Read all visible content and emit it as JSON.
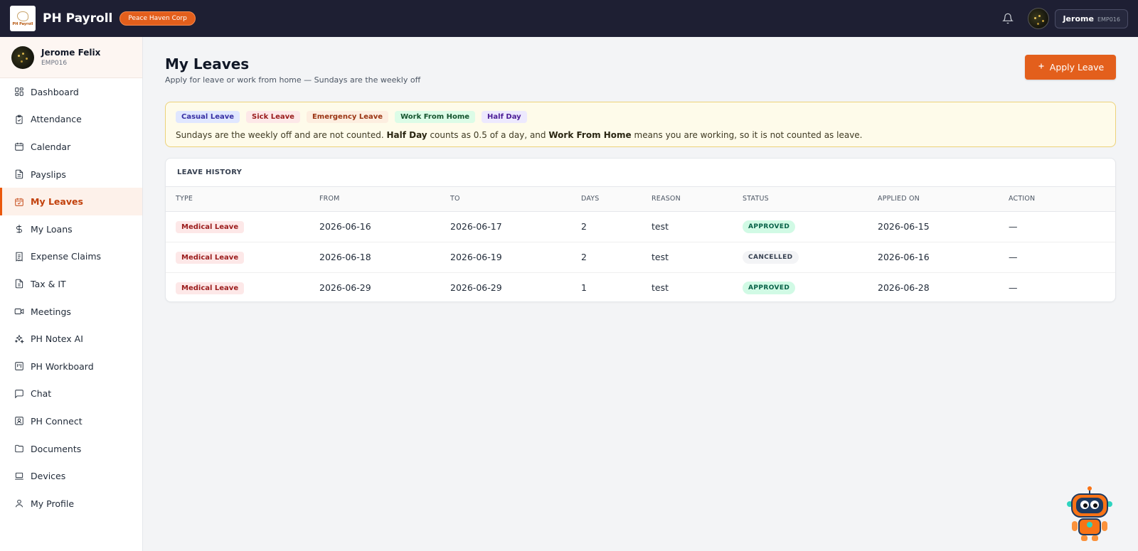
{
  "topbar": {
    "logo_text": "PH Payroll",
    "brand": "PH Payroll",
    "org": "Peace Haven Corp",
    "user_name": "Jerome",
    "user_id": "EMP016"
  },
  "sidebar": {
    "profile": {
      "name": "Jerome Felix",
      "id": "EMP016"
    },
    "items": [
      {
        "label": "Dashboard",
        "icon": "dashboard-icon"
      },
      {
        "label": "Attendance",
        "icon": "clipboard-check-icon"
      },
      {
        "label": "Calendar",
        "icon": "calendar-icon"
      },
      {
        "label": "Payslips",
        "icon": "document-icon"
      },
      {
        "label": "My Leaves",
        "icon": "calendar-check-icon",
        "active": true
      },
      {
        "label": "My Loans",
        "icon": "dollar-icon"
      },
      {
        "label": "Expense Claims",
        "icon": "receipt-icon"
      },
      {
        "label": "Tax & IT",
        "icon": "file-text-icon"
      },
      {
        "label": "Meetings",
        "icon": "video-icon"
      },
      {
        "label": "PH Notex AI",
        "icon": "sparkles-icon"
      },
      {
        "label": "PH Workboard",
        "icon": "kanban-icon"
      },
      {
        "label": "Chat",
        "icon": "chat-icon"
      },
      {
        "label": "PH Connect",
        "icon": "contact-card-icon"
      },
      {
        "label": "Documents",
        "icon": "folder-icon"
      },
      {
        "label": "Devices",
        "icon": "laptop-icon"
      },
      {
        "label": "My Profile",
        "icon": "user-icon"
      }
    ]
  },
  "page": {
    "title": "My Leaves",
    "subtitle": "Apply for leave or work from home — Sundays are the weekly off",
    "apply_button": "Apply Leave"
  },
  "notice": {
    "tags": [
      "Casual Leave",
      "Sick Leave",
      "Emergency Leave",
      "Work From Home",
      "Half Day"
    ],
    "text_1": "Sundays are the weekly off and are not counted. ",
    "bold_1": "Half Day",
    "text_2": " counts as 0.5 of a day, and ",
    "bold_2": "Work From Home",
    "text_3": " means you are working, so it is not counted as leave."
  },
  "leave_history": {
    "title": "LEAVE HISTORY",
    "columns": [
      "TYPE",
      "FROM",
      "TO",
      "DAYS",
      "REASON",
      "STATUS",
      "APPLIED ON",
      "ACTION"
    ],
    "rows": [
      {
        "type": "Medical Leave",
        "from": "2026-06-16",
        "to": "2026-06-17",
        "days": "2",
        "reason": "test",
        "status": "APPROVED",
        "applied_on": "2026-06-15",
        "action": "—"
      },
      {
        "type": "Medical Leave",
        "from": "2026-06-18",
        "to": "2026-06-19",
        "days": "2",
        "reason": "test",
        "status": "CANCELLED",
        "applied_on": "2026-06-16",
        "action": "—"
      },
      {
        "type": "Medical Leave",
        "from": "2026-06-29",
        "to": "2026-06-29",
        "days": "1",
        "reason": "test",
        "status": "APPROVED",
        "applied_on": "2026-06-28",
        "action": "—"
      }
    ]
  },
  "colors": {
    "accent": "#e35f1c",
    "topbar_bg": "#1e1f33",
    "approved": "#065f46",
    "notice_bg": "#fefbea"
  }
}
